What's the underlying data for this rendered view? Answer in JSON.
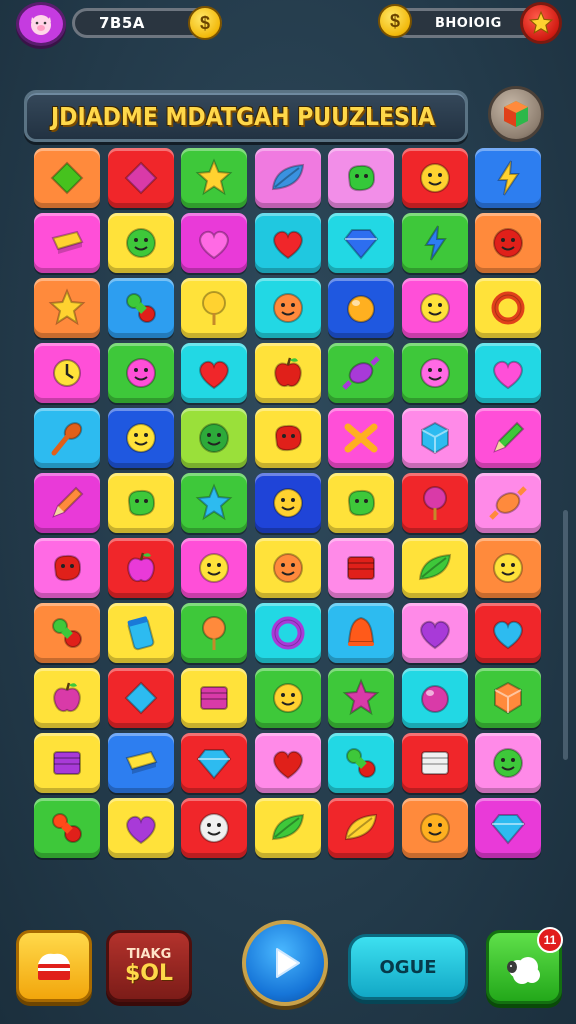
{
  "header": {
    "left_counter": "7B5A",
    "right_counter": "BHOIOIG",
    "coin_symbol": "$",
    "coin_symbol_right": "$"
  },
  "title": {
    "text": "JDIADME MDATGAH PUUZLESIA"
  },
  "board": {
    "cols": 7,
    "rows": 11,
    "tiles": [
      [
        {
          "bg": "#ff8a3c",
          "icon": "diamond",
          "fg": "#46c21e"
        },
        {
          "bg": "#f0262a",
          "icon": "diamond",
          "fg": "#d93aa8"
        },
        {
          "bg": "#3ec83a",
          "icon": "star",
          "fg": "#ffd230"
        },
        {
          "bg": "#f07ae0",
          "icon": "leaf",
          "fg": "#3a92e0"
        },
        {
          "bg": "#f28ee8",
          "icon": "blob",
          "fg": "#35c83a"
        },
        {
          "bg": "#f0262a",
          "icon": "face",
          "fg": "#ffd230"
        },
        {
          "bg": "#2d7ef0",
          "icon": "bolt",
          "fg": "#ffd230"
        }
      ],
      [
        {
          "bg": "#ff4fd8",
          "icon": "bar",
          "fg": "#ffd230"
        },
        {
          "bg": "#ffe23a",
          "icon": "face",
          "fg": "#3ec83a"
        },
        {
          "bg": "#e93ad8",
          "icon": "heart",
          "fg": "#ff6ae4"
        },
        {
          "bg": "#20c8e0",
          "icon": "heart",
          "fg": "#f0262a"
        },
        {
          "bg": "#22d8e4",
          "icon": "gem",
          "fg": "#2d6ef0"
        },
        {
          "bg": "#3ec83a",
          "icon": "bolt",
          "fg": "#2d7ef0"
        },
        {
          "bg": "#ff8a3c",
          "icon": "face",
          "fg": "#e0201a"
        }
      ],
      [
        {
          "bg": "#ff8a3c",
          "icon": "star",
          "fg": "#ffd230"
        },
        {
          "bg": "#2d9ef0",
          "icon": "pill",
          "fg": "#3ec83a"
        },
        {
          "bg": "#ffe23a",
          "icon": "lolly",
          "fg": "#ffd230"
        },
        {
          "bg": "#22d8e4",
          "icon": "face",
          "fg": "#ff8a3c"
        },
        {
          "bg": "#1f58e0",
          "icon": "orb",
          "fg": "#ffb020"
        },
        {
          "bg": "#ff4fd8",
          "icon": "face",
          "fg": "#ffe23a"
        },
        {
          "bg": "#ffe23a",
          "icon": "ring",
          "fg": "#e0401a"
        }
      ],
      [
        {
          "bg": "#ff4fd8",
          "icon": "clock",
          "fg": "#ffe23a"
        },
        {
          "bg": "#3ec83a",
          "icon": "face",
          "fg": "#ff4fd8"
        },
        {
          "bg": "#22d8e4",
          "icon": "heart",
          "fg": "#f0262a"
        },
        {
          "bg": "#ffe23a",
          "icon": "apple",
          "fg": "#e0201a"
        },
        {
          "bg": "#3ec83a",
          "icon": "candy",
          "fg": "#a83ad8"
        },
        {
          "bg": "#3ec83a",
          "icon": "face",
          "fg": "#ff6ae4"
        },
        {
          "bg": "#22d8e4",
          "icon": "heart",
          "fg": "#ff4fd8"
        }
      ],
      [
        {
          "bg": "#2dbbf0",
          "icon": "spoon",
          "fg": "#e0601a"
        },
        {
          "bg": "#1f58e0",
          "icon": "face",
          "fg": "#ffe23a"
        },
        {
          "bg": "#9ae03a",
          "icon": "face",
          "fg": "#2daa3a"
        },
        {
          "bg": "#ffe23a",
          "icon": "blob",
          "fg": "#e0201a"
        },
        {
          "bg": "#ff4fd8",
          "icon": "cross",
          "fg": "#ffb020"
        },
        {
          "bg": "#ff8ae8",
          "icon": "cube",
          "fg": "#2dbbf0"
        },
        {
          "bg": "#ff4fd8",
          "icon": "pencil",
          "fg": "#3ec83a"
        }
      ],
      [
        {
          "bg": "#e93ad8",
          "icon": "pencil",
          "fg": "#ff8a3c"
        },
        {
          "bg": "#ffe23a",
          "icon": "blob",
          "fg": "#3ec83a"
        },
        {
          "bg": "#3ec83a",
          "icon": "star",
          "fg": "#2dbbf0"
        },
        {
          "bg": "#1f44d8",
          "icon": "face",
          "fg": "#ffd230"
        },
        {
          "bg": "#ffe23a",
          "icon": "blob",
          "fg": "#3ec83a"
        },
        {
          "bg": "#f0262a",
          "icon": "lolly",
          "fg": "#d93aa8"
        },
        {
          "bg": "#ff8ae8",
          "icon": "candy",
          "fg": "#ff8a3c"
        }
      ],
      [
        {
          "bg": "#ff6ae4",
          "icon": "blob",
          "fg": "#e0201a"
        },
        {
          "bg": "#f0262a",
          "icon": "apple",
          "fg": "#e93ad8"
        },
        {
          "bg": "#ff4fd8",
          "icon": "face",
          "fg": "#ffe23a"
        },
        {
          "bg": "#ffe23a",
          "icon": "face",
          "fg": "#ff8a3c"
        },
        {
          "bg": "#ff8ae8",
          "icon": "box",
          "fg": "#e0201a"
        },
        {
          "bg": "#ffe23a",
          "icon": "leaf",
          "fg": "#3ec83a"
        },
        {
          "bg": "#ff8a3c",
          "icon": "face",
          "fg": "#ffe23a"
        }
      ],
      [
        {
          "bg": "#ff8a3c",
          "icon": "pill",
          "fg": "#3ec83a"
        },
        {
          "bg": "#ffe23a",
          "icon": "jar",
          "fg": "#2dbbf0"
        },
        {
          "bg": "#3ec83a",
          "icon": "lolly",
          "fg": "#ff8a3c"
        },
        {
          "bg": "#22d8e4",
          "icon": "ring",
          "fg": "#a83ad8"
        },
        {
          "bg": "#2dbbf0",
          "icon": "bell",
          "fg": "#ff5a1a"
        },
        {
          "bg": "#ff8ae8",
          "icon": "heart",
          "fg": "#a83ad8"
        },
        {
          "bg": "#f0262a",
          "icon": "heart",
          "fg": "#2dbbf0"
        }
      ],
      [
        {
          "bg": "#ffe23a",
          "icon": "apple",
          "fg": "#d93aa8"
        },
        {
          "bg": "#f0262a",
          "icon": "diamond",
          "fg": "#2dbbf0"
        },
        {
          "bg": "#ffe23a",
          "icon": "box",
          "fg": "#d93aa8"
        },
        {
          "bg": "#3ec83a",
          "icon": "face",
          "fg": "#ffd230"
        },
        {
          "bg": "#3ec83a",
          "icon": "star",
          "fg": "#d93aa8"
        },
        {
          "bg": "#22d8e4",
          "icon": "orb",
          "fg": "#d93aa8"
        },
        {
          "bg": "#3ec83a",
          "icon": "cube",
          "fg": "#ff8a3c"
        }
      ],
      [
        {
          "bg": "#ffe23a",
          "icon": "box",
          "fg": "#a83ad8"
        },
        {
          "bg": "#2d7ef0",
          "icon": "bar",
          "fg": "#ffe23a"
        },
        {
          "bg": "#f0262a",
          "icon": "gem",
          "fg": "#2dbbf0"
        },
        {
          "bg": "#ff8ae8",
          "icon": "heart",
          "fg": "#e0201a"
        },
        {
          "bg": "#22d8e4",
          "icon": "pill",
          "fg": "#3ec83a"
        },
        {
          "bg": "#f0262a",
          "icon": "box",
          "fg": "#f0f0f0"
        },
        {
          "bg": "#ff8ae8",
          "icon": "face",
          "fg": "#3ec83a"
        }
      ],
      [
        {
          "bg": "#3ec83a",
          "icon": "pill",
          "fg": "#ff4a1a"
        },
        {
          "bg": "#ffe23a",
          "icon": "heart",
          "fg": "#a83ad8"
        },
        {
          "bg": "#f0262a",
          "icon": "face",
          "fg": "#f0f0f0"
        },
        {
          "bg": "#ffe23a",
          "icon": "leaf",
          "fg": "#3ec83a"
        },
        {
          "bg": "#f0262a",
          "icon": "leaf",
          "fg": "#ffd230"
        },
        {
          "bg": "#ff8a3c",
          "icon": "face",
          "fg": "#ffb020"
        },
        {
          "bg": "#e93ad8",
          "icon": "gem",
          "fg": "#2dbbf0"
        }
      ]
    ]
  },
  "bottom": {
    "score_label": "TIAKG",
    "score_value": "$OL",
    "action_label": "OGUE",
    "notification_count": "11"
  },
  "icons": {
    "avatar": "pig-avatar-icon",
    "header_badge": "star-icon",
    "cube_button": "cube-icon",
    "cake_button": "cake-icon",
    "play_button": "play-icon",
    "sheep_button": "sheep-icon"
  },
  "colors": {
    "background": "#233a4a",
    "title": "#ffd84a"
  }
}
